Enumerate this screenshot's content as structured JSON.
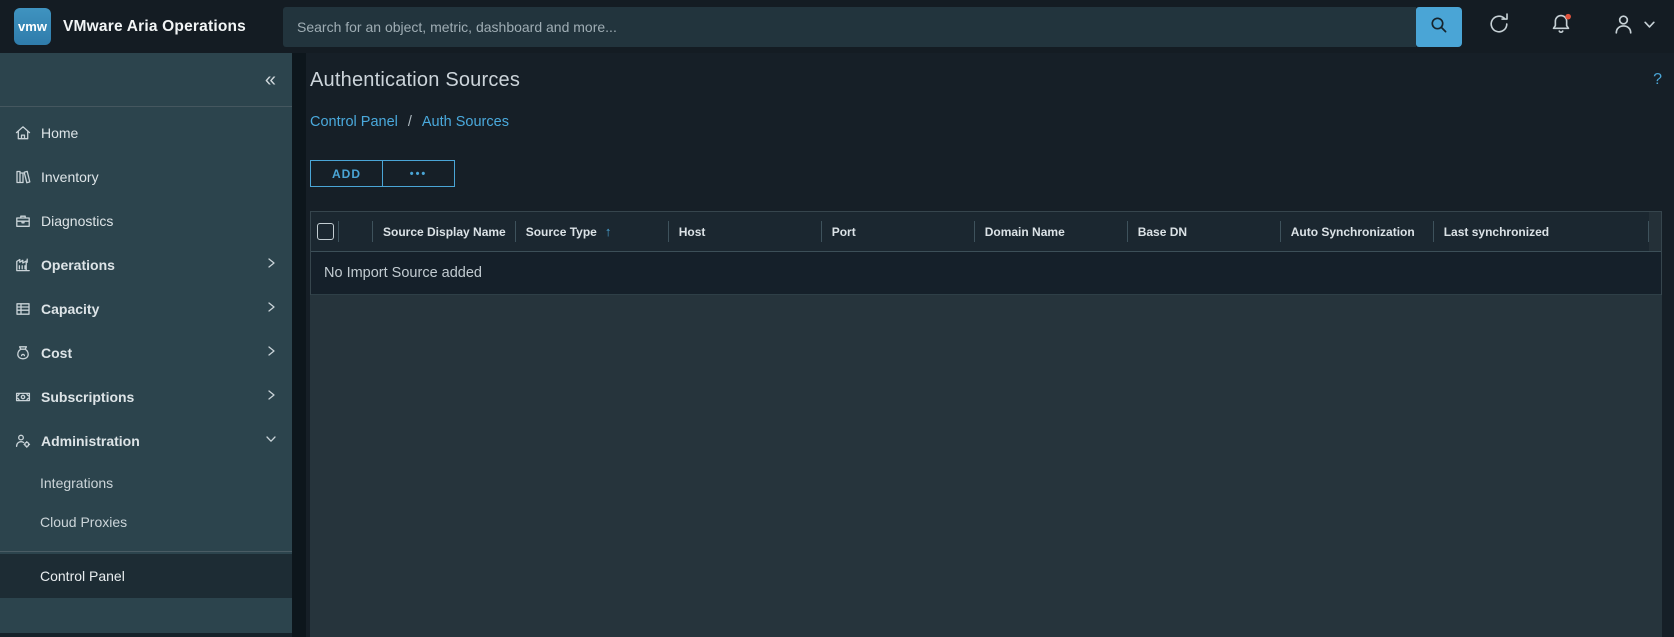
{
  "topbar": {
    "logo_text": "vmw",
    "app_title": "VMware Aria Operations",
    "search_placeholder": "Search for an object, metric, dashboard and more..."
  },
  "sidebar": {
    "collapse_glyph": "«",
    "items": [
      {
        "label": "Home",
        "icon": "home-icon",
        "expandable": false
      },
      {
        "label": "Inventory",
        "icon": "inventory-icon",
        "expandable": false
      },
      {
        "label": "Diagnostics",
        "icon": "diagnostics-icon",
        "expandable": false
      },
      {
        "label": "Operations",
        "icon": "operations-icon",
        "expandable": true
      },
      {
        "label": "Capacity",
        "icon": "capacity-icon",
        "expandable": true
      },
      {
        "label": "Cost",
        "icon": "cost-icon",
        "expandable": true
      },
      {
        "label": "Subscriptions",
        "icon": "subscriptions-icon",
        "expandable": true
      },
      {
        "label": "Administration",
        "icon": "administration-icon",
        "expandable": true,
        "expanded": true
      }
    ],
    "sub_items": [
      {
        "label": "Integrations"
      },
      {
        "label": "Cloud Proxies"
      }
    ],
    "selected_item": {
      "label": "Control Panel"
    }
  },
  "main": {
    "page_title": "Authentication Sources",
    "help_label": "?",
    "breadcrumb": {
      "items": [
        {
          "label": "Control Panel"
        },
        {
          "label": "Auth Sources"
        }
      ],
      "separator": "/"
    },
    "toolbar": {
      "add_label": "ADD",
      "more_label": "•••"
    },
    "table": {
      "columns": [
        {
          "label": "Source Display Name"
        },
        {
          "label": "Source Type",
          "sorted": "ascending",
          "sort_glyph": "↑"
        },
        {
          "label": "Host"
        },
        {
          "label": "Port"
        },
        {
          "label": "Domain Name"
        },
        {
          "label": "Base DN"
        },
        {
          "label": "Auto Synchronization"
        },
        {
          "label": "Last synchronized"
        }
      ],
      "empty_message": "No Import Source added"
    }
  },
  "colors": {
    "accent_blue": "#4aa5d6",
    "logo_blue": "#3589ba",
    "topbar_bg": "#141c23",
    "sidebar_bg": "#2c444d",
    "content_bg": "#161f27",
    "empty_area_bg": "#26343c",
    "notification_badge_red": "#e0533d"
  }
}
